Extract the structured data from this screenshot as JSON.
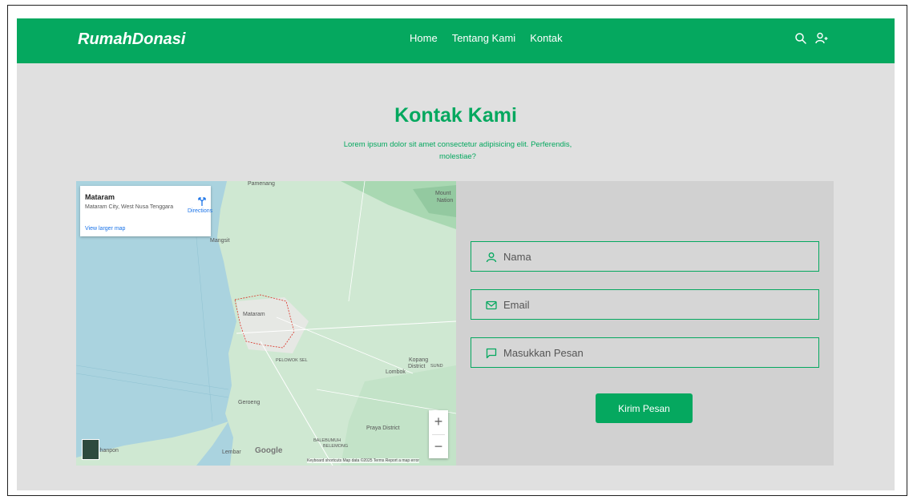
{
  "navbar": {
    "brand": "RumahDonasi",
    "links": [
      "Home",
      "Tentang Kami",
      "Kontak"
    ],
    "icons": [
      "search-icon",
      "user-add-icon"
    ],
    "color": "#05a85f"
  },
  "header": {
    "title": "Kontak Kami",
    "subtitle": "Lorem ipsum dolor sit amet consectetur adipisicing elit. Perferendis, molestiae?"
  },
  "map": {
    "place_name": "Mataram",
    "place_address": "Mataram City, West Nusa Tenggara",
    "directions_label": "Directions",
    "larger_map_link": "View larger map",
    "labels": {
      "pamenang": "Pamenang",
      "mount": "Mount",
      "nation": "Nation",
      "mangsit": "Mangsit",
      "mataram": "Mataram",
      "pelowok": "PELOWOK SEL",
      "kopang": "Kopang",
      "district": "District",
      "sund": "SUND",
      "lombok": "Lombok",
      "geroeng": "Geroeng",
      "praya": "Praya District",
      "balebumuh": "BALEBUMUH",
      "belemong": "BELEMONG",
      "lembar": "Lembar",
      "ihanpon": "ihanpon"
    },
    "zoom_in": "+",
    "zoom_out": "−",
    "google": "Google",
    "attribution": "Keyboard shortcuts   Map data ©2025   Terms   Report a map error"
  },
  "form": {
    "name_placeholder": "Nama",
    "email_placeholder": "Email",
    "message_placeholder": "Masukkan Pesan",
    "submit_label": "Kirim Pesan"
  }
}
